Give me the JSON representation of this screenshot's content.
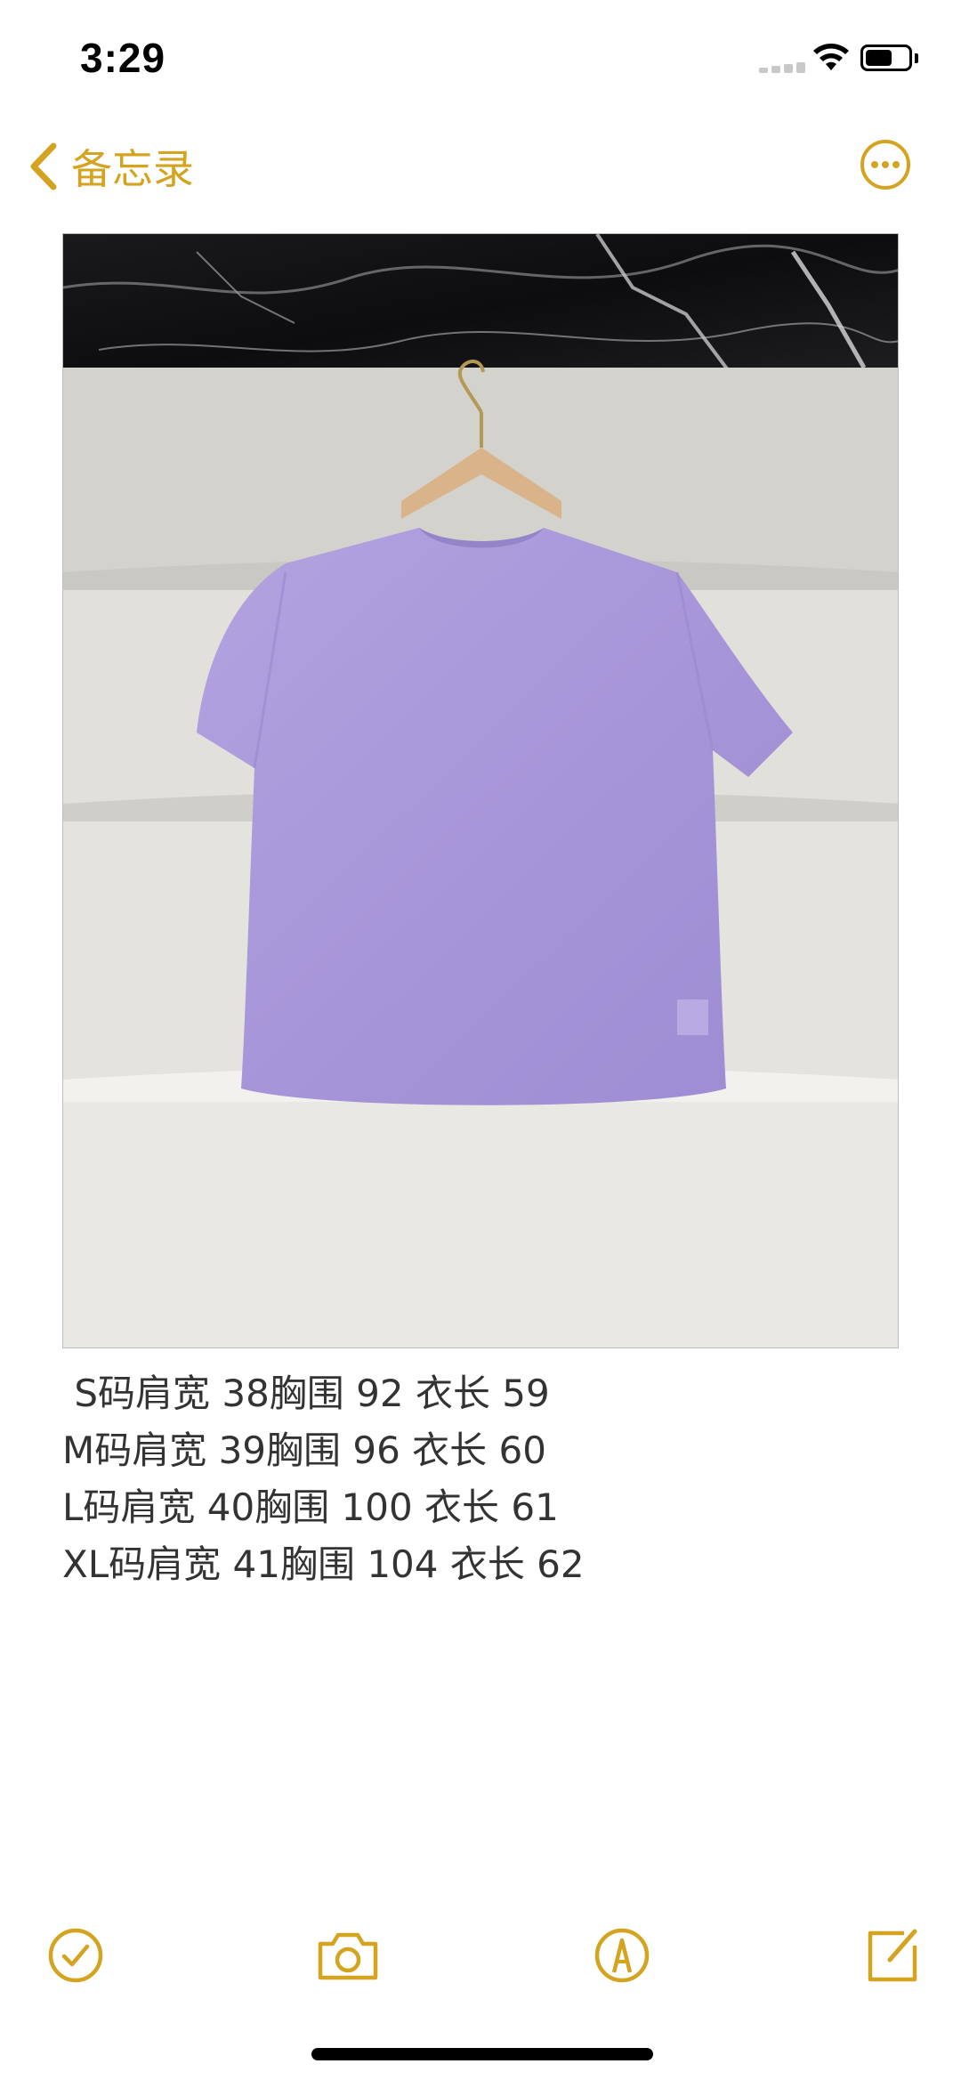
{
  "status_bar": {
    "time": "3:29",
    "battery_level": 0.62
  },
  "nav": {
    "back_label": "备忘录",
    "back_icon": "chevron-left-icon",
    "more_icon": "ellipsis-circle-icon"
  },
  "note": {
    "image_description_icon": "photo",
    "lines": [
      " S码肩宽 38胸围 92 衣长 59",
      "M码肩宽 39胸围 96 衣长 60",
      "L码肩宽 40胸围 100 衣长 61",
      "XL码肩宽 41胸围 104 衣长 62"
    ]
  },
  "toolbar": {
    "items": [
      "checklist-icon",
      "camera-icon",
      "markup-icon",
      "compose-icon"
    ]
  },
  "colors": {
    "accent": "#D4A31F",
    "text": "#333333",
    "shirt": "#A796D9"
  }
}
